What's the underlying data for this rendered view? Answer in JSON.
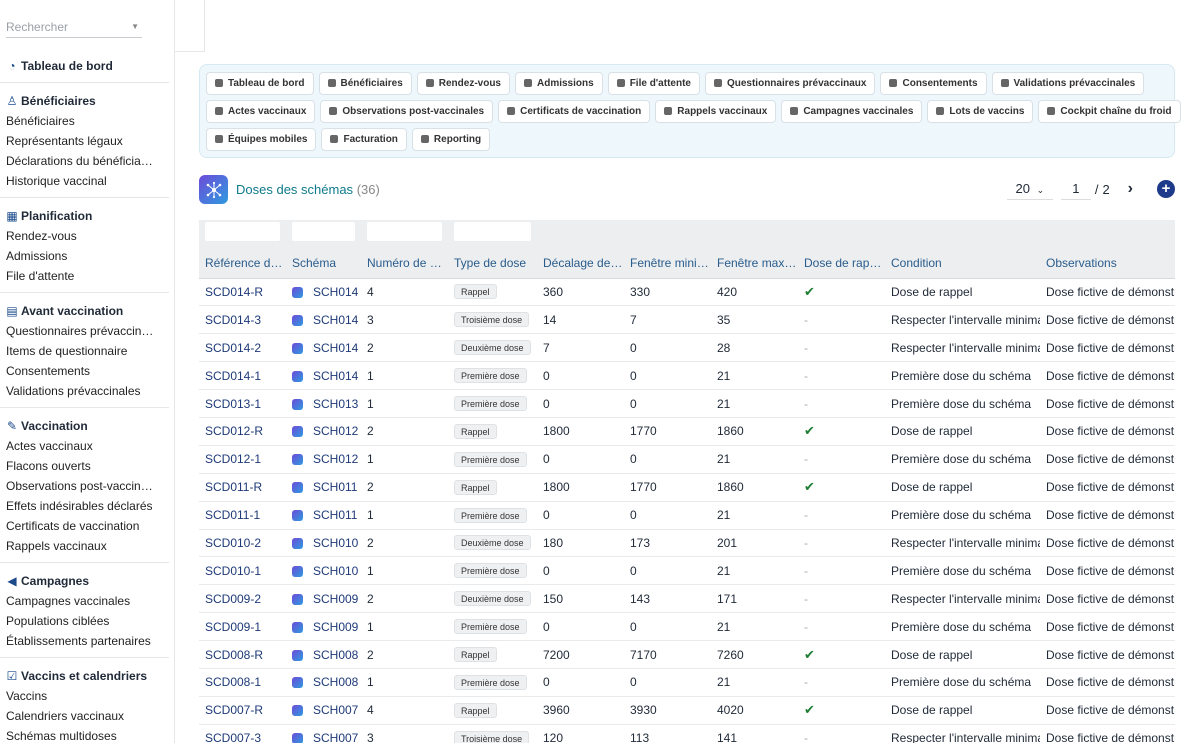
{
  "sidebar": {
    "search_placeholder": "Rechercher",
    "groups": [
      {
        "label": "Tableau de bord",
        "icon": "dashboard-icon",
        "items": []
      },
      {
        "label": "Bénéficiaires",
        "icon": "people-icon",
        "items": [
          "Bénéficiaires",
          "Représentants légaux",
          "Déclarations du bénéficia…",
          "Historique vaccinal"
        ]
      },
      {
        "label": "Planification",
        "icon": "calendar-icon",
        "items": [
          "Rendez-vous",
          "Admissions",
          "File d'attente"
        ]
      },
      {
        "label": "Avant vaccination",
        "icon": "clipboard-icon",
        "items": [
          "Questionnaires prévaccin…",
          "Items de questionnaire",
          "Consentements",
          "Validations prévaccinales"
        ]
      },
      {
        "label": "Vaccination",
        "icon": "syringe-icon",
        "items": [
          "Actes vaccinaux",
          "Flacons ouverts",
          "Observations post-vaccin…",
          "Effets indésirables déclarés",
          "Certificats de vaccination",
          "Rappels vaccinaux"
        ]
      },
      {
        "label": "Campagnes",
        "icon": "megaphone-icon",
        "items": [
          "Campagnes vaccinales",
          "Populations ciblées",
          "Établissements partenaires"
        ]
      },
      {
        "label": "Vaccins et calendriers",
        "icon": "calendar-check-icon",
        "items": [
          "Vaccins",
          "Calendriers vaccinaux",
          "Schémas multidoses"
        ]
      }
    ]
  },
  "nav": {
    "rows": [
      [
        "Tableau de bord",
        "Bénéficiaires",
        "Rendez-vous",
        "Admissions",
        "File d'attente",
        "Questionnaires prévaccinaux",
        "Consentements",
        "Validations prévaccinales"
      ],
      [
        "Actes vaccinaux",
        "Observations post-vaccinales",
        "Certificats de vaccination",
        "Rappels vaccinaux",
        "Campagnes vaccinales",
        "Lots de vaccins",
        "Cockpit chaîne du froid"
      ],
      [
        "Équipes mobiles",
        "Facturation",
        "Reporting"
      ]
    ]
  },
  "header": {
    "title": "Doses des schémas",
    "count": "(36)"
  },
  "pager": {
    "per_page": "20",
    "current": "1",
    "separator": "/",
    "total": "2"
  },
  "table": {
    "columns": [
      "Référence d…",
      "Schéma",
      "Numéro de d…",
      "Type de dose",
      "Décalage de…",
      "Fenêtre mini…",
      "Fenêtre max…",
      "Dose de rappel",
      "Condition",
      "Observations"
    ],
    "rows": [
      [
        "SCD014-R",
        "SCH014",
        "4",
        "Rappel",
        "360",
        "330",
        "420",
        true,
        "Dose de rappel",
        "Dose fictive de démonstrat"
      ],
      [
        "SCD014-3",
        "SCH014",
        "3",
        "Troisième dose",
        "14",
        "7",
        "35",
        false,
        "Respecter l'intervalle minimal",
        "Dose fictive de démonstrat"
      ],
      [
        "SCD014-2",
        "SCH014",
        "2",
        "Deuxième dose",
        "7",
        "0",
        "28",
        false,
        "Respecter l'intervalle minimal",
        "Dose fictive de démonstrat"
      ],
      [
        "SCD014-1",
        "SCH014",
        "1",
        "Première dose",
        "0",
        "0",
        "21",
        false,
        "Première dose du schéma",
        "Dose fictive de démonstrat"
      ],
      [
        "SCD013-1",
        "SCH013",
        "1",
        "Première dose",
        "0",
        "0",
        "21",
        false,
        "Première dose du schéma",
        "Dose fictive de démonstrat"
      ],
      [
        "SCD012-R",
        "SCH012",
        "2",
        "Rappel",
        "1800",
        "1770",
        "1860",
        true,
        "Dose de rappel",
        "Dose fictive de démonstrat"
      ],
      [
        "SCD012-1",
        "SCH012",
        "1",
        "Première dose",
        "0",
        "0",
        "21",
        false,
        "Première dose du schéma",
        "Dose fictive de démonstrat"
      ],
      [
        "SCD011-R",
        "SCH011",
        "2",
        "Rappel",
        "1800",
        "1770",
        "1860",
        true,
        "Dose de rappel",
        "Dose fictive de démonstrat"
      ],
      [
        "SCD011-1",
        "SCH011",
        "1",
        "Première dose",
        "0",
        "0",
        "21",
        false,
        "Première dose du schéma",
        "Dose fictive de démonstrat"
      ],
      [
        "SCD010-2",
        "SCH010",
        "2",
        "Deuxième dose",
        "180",
        "173",
        "201",
        false,
        "Respecter l'intervalle minimal",
        "Dose fictive de démonstrat"
      ],
      [
        "SCD010-1",
        "SCH010",
        "1",
        "Première dose",
        "0",
        "0",
        "21",
        false,
        "Première dose du schéma",
        "Dose fictive de démonstrat"
      ],
      [
        "SCD009-2",
        "SCH009",
        "2",
        "Deuxième dose",
        "150",
        "143",
        "171",
        false,
        "Respecter l'intervalle minimal",
        "Dose fictive de démonstrat"
      ],
      [
        "SCD009-1",
        "SCH009",
        "1",
        "Première dose",
        "0",
        "0",
        "21",
        false,
        "Première dose du schéma",
        "Dose fictive de démonstrat"
      ],
      [
        "SCD008-R",
        "SCH008",
        "2",
        "Rappel",
        "7200",
        "7170",
        "7260",
        true,
        "Dose de rappel",
        "Dose fictive de démonstrat"
      ],
      [
        "SCD008-1",
        "SCH008",
        "1",
        "Première dose",
        "0",
        "0",
        "21",
        false,
        "Première dose du schéma",
        "Dose fictive de démonstrat"
      ],
      [
        "SCD007-R",
        "SCH007",
        "4",
        "Rappel",
        "3960",
        "3930",
        "4020",
        true,
        "Dose de rappel",
        "Dose fictive de démonstrat"
      ],
      [
        "SCD007-3",
        "SCH007",
        "3",
        "Troisième dose",
        "120",
        "113",
        "141",
        false,
        "Respecter l'intervalle minimal",
        "Dose fictive de démonstrat"
      ]
    ],
    "dash": "-",
    "check": "✔"
  },
  "colors": {
    "accent": "#0e7a8c",
    "link": "#1e3a78",
    "nav_bg": "#eef7fb"
  }
}
